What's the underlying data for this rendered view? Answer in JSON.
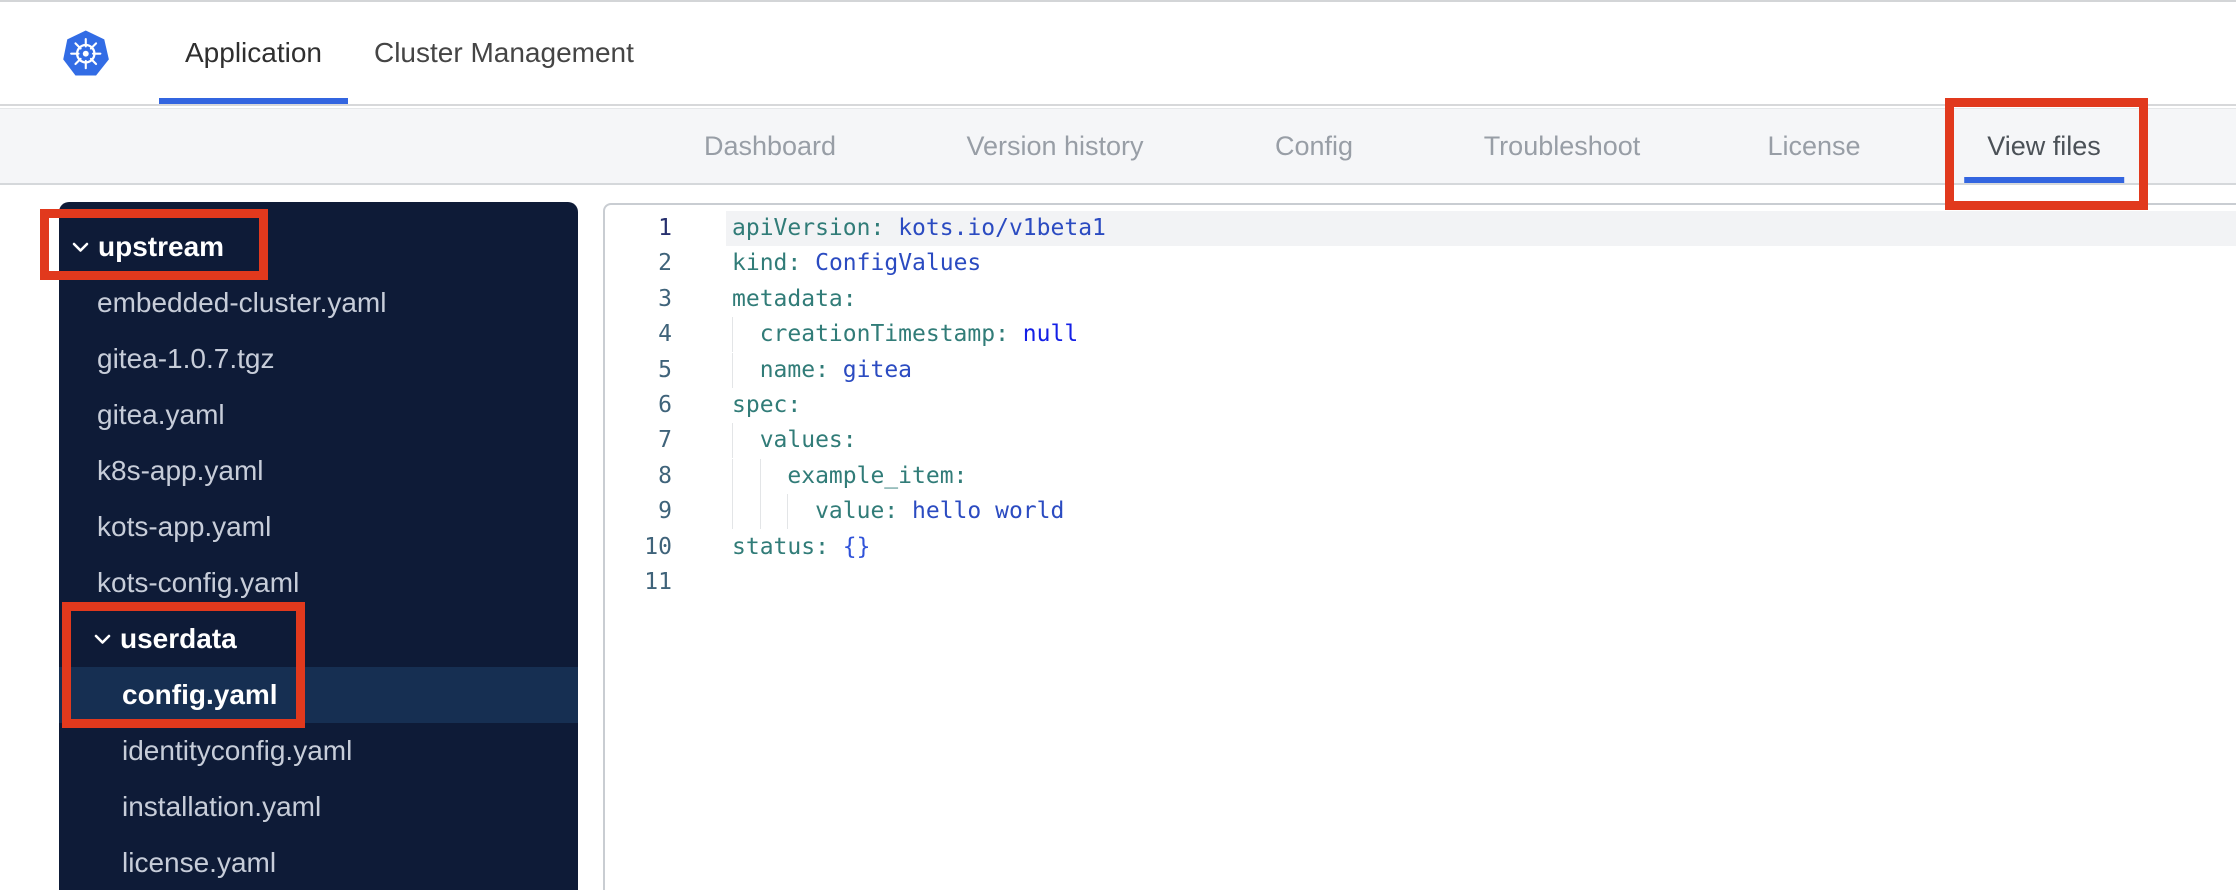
{
  "header": {
    "logo": "kubernetes-logo",
    "tabs": [
      {
        "label": "Application",
        "active": true
      },
      {
        "label": "Cluster Management",
        "active": false
      }
    ]
  },
  "subnav": {
    "tabs": [
      {
        "label": "Dashboard",
        "active": false
      },
      {
        "label": "Version history",
        "active": false
      },
      {
        "label": "Config",
        "active": false
      },
      {
        "label": "Troubleshoot",
        "active": false
      },
      {
        "label": "License",
        "active": false
      },
      {
        "label": "View files",
        "active": true
      }
    ]
  },
  "sidebar": {
    "items": [
      {
        "type": "folder",
        "label": "upstream",
        "level": 0,
        "expanded": true,
        "selected": false
      },
      {
        "type": "file",
        "label": "embedded-cluster.yaml",
        "level": 1,
        "selected": false
      },
      {
        "type": "file",
        "label": "gitea-1.0.7.tgz",
        "level": 1,
        "selected": false
      },
      {
        "type": "file",
        "label": "gitea.yaml",
        "level": 1,
        "selected": false
      },
      {
        "type": "file",
        "label": "k8s-app.yaml",
        "level": 1,
        "selected": false
      },
      {
        "type": "file",
        "label": "kots-app.yaml",
        "level": 1,
        "selected": false
      },
      {
        "type": "file",
        "label": "kots-config.yaml",
        "level": 1,
        "selected": false
      },
      {
        "type": "folder",
        "label": "userdata",
        "level": 1,
        "expanded": true,
        "selected": false
      },
      {
        "type": "file",
        "label": "config.yaml",
        "level": 2,
        "selected": true
      },
      {
        "type": "file",
        "label": "identityconfig.yaml",
        "level": 2,
        "selected": false
      },
      {
        "type": "file",
        "label": "installation.yaml",
        "level": 2,
        "selected": false
      },
      {
        "type": "file",
        "label": "license.yaml",
        "level": 2,
        "selected": false
      }
    ]
  },
  "editor": {
    "language": "yaml",
    "lines": [
      {
        "n": 1,
        "active": true,
        "indent": 0,
        "tokens": [
          [
            "key",
            "apiVersion:"
          ],
          [
            "sp",
            " "
          ],
          [
            "val",
            "kots.io/v1beta1"
          ]
        ]
      },
      {
        "n": 2,
        "active": false,
        "indent": 0,
        "tokens": [
          [
            "key",
            "kind:"
          ],
          [
            "sp",
            " "
          ],
          [
            "val",
            "ConfigValues"
          ]
        ]
      },
      {
        "n": 3,
        "active": false,
        "indent": 0,
        "tokens": [
          [
            "key",
            "metadata:"
          ]
        ]
      },
      {
        "n": 4,
        "active": false,
        "indent": 1,
        "tokens": [
          [
            "key",
            "creationTimestamp:"
          ],
          [
            "sp",
            " "
          ],
          [
            "kw",
            "null"
          ]
        ]
      },
      {
        "n": 5,
        "active": false,
        "indent": 1,
        "tokens": [
          [
            "key",
            "name:"
          ],
          [
            "sp",
            " "
          ],
          [
            "val",
            "gitea"
          ]
        ]
      },
      {
        "n": 6,
        "active": false,
        "indent": 0,
        "tokens": [
          [
            "key",
            "spec:"
          ]
        ]
      },
      {
        "n": 7,
        "active": false,
        "indent": 1,
        "tokens": [
          [
            "key",
            "values:"
          ]
        ]
      },
      {
        "n": 8,
        "active": false,
        "indent": 2,
        "tokens": [
          [
            "key",
            "example_item:"
          ]
        ]
      },
      {
        "n": 9,
        "active": false,
        "indent": 3,
        "tokens": [
          [
            "key",
            "value:"
          ],
          [
            "sp",
            " "
          ],
          [
            "val",
            "hello world"
          ]
        ]
      },
      {
        "n": 10,
        "active": false,
        "indent": 0,
        "tokens": [
          [
            "key",
            "status:"
          ],
          [
            "sp",
            " "
          ],
          [
            "punc",
            "{}"
          ]
        ]
      },
      {
        "n": 11,
        "active": false,
        "indent": 0,
        "tokens": []
      }
    ]
  },
  "annotations": [
    {
      "id": "view-files-tab"
    },
    {
      "id": "upstream-folder"
    },
    {
      "id": "userdata-config"
    }
  ],
  "colors": {
    "accent_blue": "#3365e0",
    "kubernetes_blue": "#326ce5",
    "annotation_red": "#e1391d",
    "sidebar_bg": "#0e1b37",
    "sidebar_selected": "#162f52",
    "yaml_key": "#317c78",
    "yaml_value": "#2b4bc1",
    "yaml_null": "#1420e6"
  }
}
